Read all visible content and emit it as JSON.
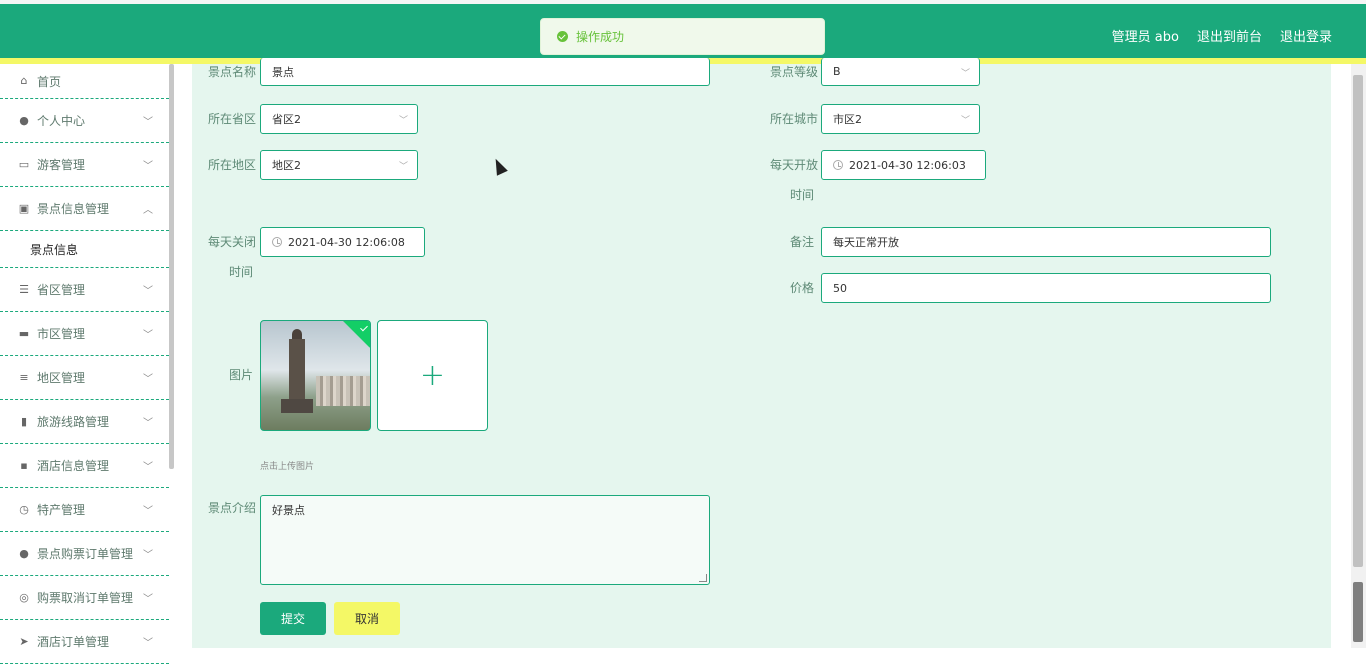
{
  "header": {
    "admin_label": "管理员 abo",
    "to_front_label": "退出到前台",
    "logout_label": "退出登录"
  },
  "toast": {
    "message": "操作成功"
  },
  "sidebar": {
    "items": [
      {
        "label": "首页",
        "icon": "home-icon"
      },
      {
        "label": "个人中心",
        "icon": "user-icon"
      },
      {
        "label": "游客管理",
        "icon": "card-icon"
      },
      {
        "label": "景点信息管理",
        "icon": "clipboard-icon",
        "expanded": true,
        "sub": "景点信息"
      },
      {
        "label": "省区管理",
        "icon": "list-icon"
      },
      {
        "label": "市区管理",
        "icon": "bus-icon"
      },
      {
        "label": "地区管理",
        "icon": "sliders-icon"
      },
      {
        "label": "旅游线路管理",
        "icon": "ticket-icon"
      },
      {
        "label": "酒店信息管理",
        "icon": "chat-icon"
      },
      {
        "label": "特产管理",
        "icon": "clock-icon"
      },
      {
        "label": "景点购票订单管理",
        "icon": "user-icon"
      },
      {
        "label": "购票取消订单管理",
        "icon": "compass-icon"
      },
      {
        "label": "酒店订单管理",
        "icon": "send-icon"
      }
    ]
  },
  "form": {
    "name_label": "景点名称",
    "name_value": "景点",
    "level_label": "景点等级",
    "level_value": "B",
    "province_label": "所在省区",
    "province_value": "省区2",
    "city_label": "所在城市",
    "city_value": "市区2",
    "area_label": "所在地区",
    "area_value": "地区2",
    "open_label_1": "每天开放",
    "open_label_2": "时间",
    "open_value": "2021-04-30 12:06:03",
    "close_label_1": "每天关闭",
    "close_label_2": "时间",
    "close_value": "2021-04-30 12:06:08",
    "remark_label": "备注",
    "remark_value": "每天正常开放",
    "price_label": "价格",
    "price_value": "50",
    "image_label": "图片",
    "upload_tip": "点击上传图片",
    "intro_label": "景点介绍",
    "intro_value": "好景点",
    "submit_label": "提交",
    "cancel_label": "取消"
  }
}
